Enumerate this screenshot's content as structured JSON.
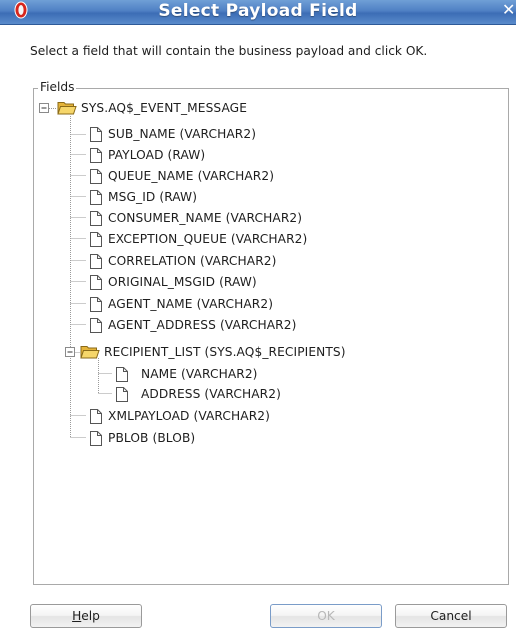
{
  "dialog": {
    "title": "Select Payload Field",
    "close_glyph": "✕",
    "instruction": "Select a field that will contain the business payload and click OK.",
    "group_label": "Fields"
  },
  "tree": {
    "root": "SYS.AQ$_EVENT_MESSAGE",
    "items": [
      "SUB_NAME (VARCHAR2)",
      "PAYLOAD (RAW)",
      "QUEUE_NAME (VARCHAR2)",
      "MSG_ID (RAW)",
      "CONSUMER_NAME (VARCHAR2)",
      "EXCEPTION_QUEUE (VARCHAR2)",
      "CORRELATION (VARCHAR2)",
      "ORIGINAL_MSGID (RAW)",
      "AGENT_NAME (VARCHAR2)",
      "AGENT_ADDRESS (VARCHAR2)",
      "RECIPIENT_LIST (SYS.AQ$_RECIPIENTS)",
      "NAME (VARCHAR2)",
      "ADDRESS (VARCHAR2)",
      "XMLPAYLOAD (VARCHAR2)",
      "PBLOB (BLOB)"
    ]
  },
  "buttons": {
    "help_mnemonic": "H",
    "help_rest": "elp",
    "ok": "OK",
    "cancel": "Cancel",
    "ok_enabled": false
  },
  "icons": {
    "app": "oracle-app-icon",
    "folder": "open-folder-icon",
    "file": "document-icon",
    "expand": "collapse-minus-icon"
  },
  "colors": {
    "titlebar": "#4f80c4",
    "folder": "#f2c84b",
    "disabled_text": "#b8b8b8"
  }
}
